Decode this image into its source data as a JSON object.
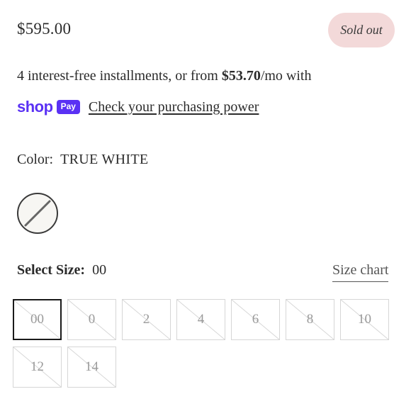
{
  "product": {
    "price": "$595.00",
    "badge": "Sold out"
  },
  "financing": {
    "text_before": "4 interest-free installments, or from ",
    "amount": "$53.70",
    "text_after": "/mo with",
    "brand_shop": "shop",
    "brand_pay": "Pay",
    "link": "Check your purchasing power",
    "brand_color": "#5a31f4"
  },
  "color": {
    "label": "Color:",
    "value": "TRUE WHITE",
    "swatch_color": "#f7f6f3",
    "swatch_icon": "unavailable-slash-icon"
  },
  "size": {
    "label": "Select Size:",
    "value": "00",
    "chart_link": "Size chart",
    "options": [
      "00",
      "0",
      "2",
      "4",
      "6",
      "8",
      "10",
      "12",
      "14"
    ],
    "selected": "00",
    "all_sold_out": true
  },
  "colors": {
    "badge_bg": "#f3d9d9",
    "text": "#2b2b2b",
    "size_border": "#d6d6d6"
  }
}
